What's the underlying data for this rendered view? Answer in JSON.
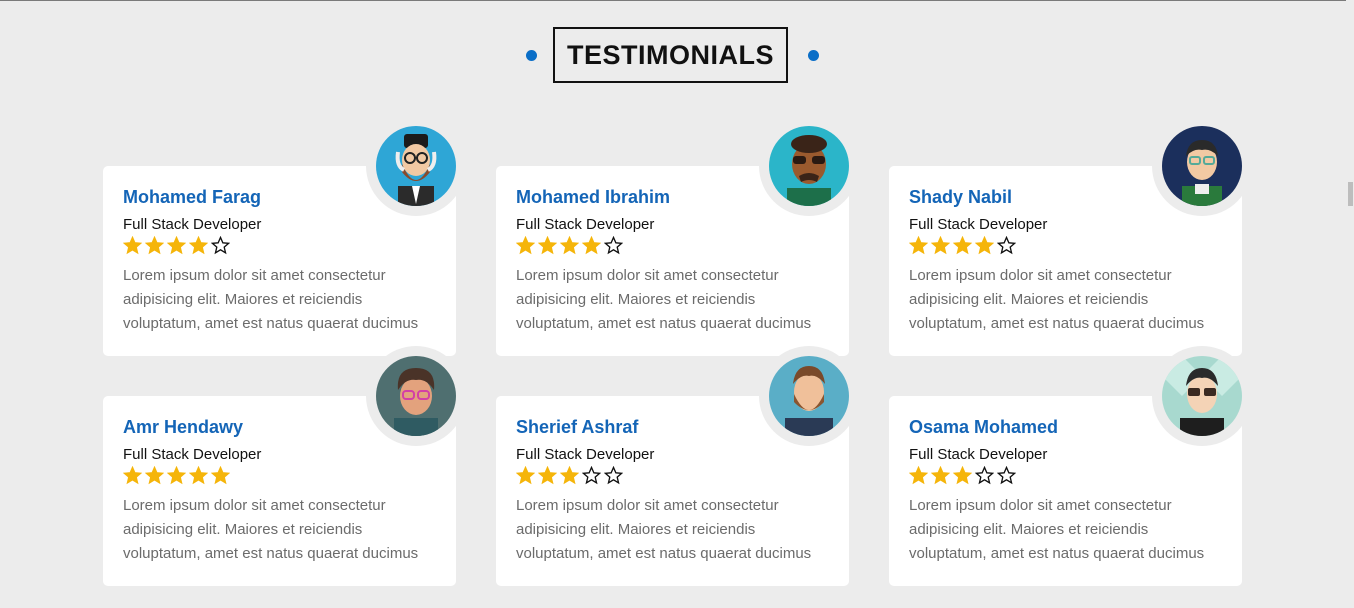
{
  "section": {
    "title": "TESTIMONIALS"
  },
  "colors": {
    "accent": "#1465b7",
    "dot": "#0a6ec7",
    "star": "#f5b50a",
    "background": "#ececec"
  },
  "testimonials": [
    {
      "name": "Mohamed Farag",
      "role": "Full Stack Developer",
      "rating": 4,
      "max_rating": 5,
      "text": "Lorem ipsum dolor sit amet consectetur adipisicing elit. Maiores et reiciendis voluptatum, amet est natus quaerat ducimus",
      "avatar": "avatar-bearded-man-icon"
    },
    {
      "name": "Mohamed Ibrahim",
      "role": "Full Stack Developer",
      "rating": 4,
      "max_rating": 5,
      "text": "Lorem ipsum dolor sit amet consectetur adipisicing elit. Maiores et reiciendis voluptatum, amet est natus quaerat ducimus",
      "avatar": "avatar-sunglasses-man-icon"
    },
    {
      "name": "Shady Nabil",
      "role": "Full Stack Developer",
      "rating": 4,
      "max_rating": 5,
      "text": "Lorem ipsum dolor sit amet consectetur adipisicing elit. Maiores et reiciendis voluptatum, amet est natus quaerat ducimus",
      "avatar": "avatar-glasses-man-icon"
    },
    {
      "name": "Amr Hendawy",
      "role": "Full Stack Developer",
      "rating": 5,
      "max_rating": 5,
      "text": "Lorem ipsum dolor sit amet consectetur adipisicing elit. Maiores et reiciendis voluptatum, amet est natus quaerat ducimus",
      "avatar": "avatar-pink-glasses-man-icon"
    },
    {
      "name": "Sherief Ashraf",
      "role": "Full Stack Developer",
      "rating": 3,
      "max_rating": 5,
      "text": "Lorem ipsum dolor sit amet consectetur adipisicing elit. Maiores et reiciendis voluptatum, amet est natus quaerat ducimus",
      "avatar": "avatar-beard-man-icon"
    },
    {
      "name": "Osama Mohamed",
      "role": "Full Stack Developer",
      "rating": 3,
      "max_rating": 5,
      "text": "Lorem ipsum dolor sit amet consectetur adipisicing elit. Maiores et reiciendis voluptatum, amet est natus quaerat ducimus",
      "avatar": "avatar-dark-glasses-man-icon"
    }
  ]
}
